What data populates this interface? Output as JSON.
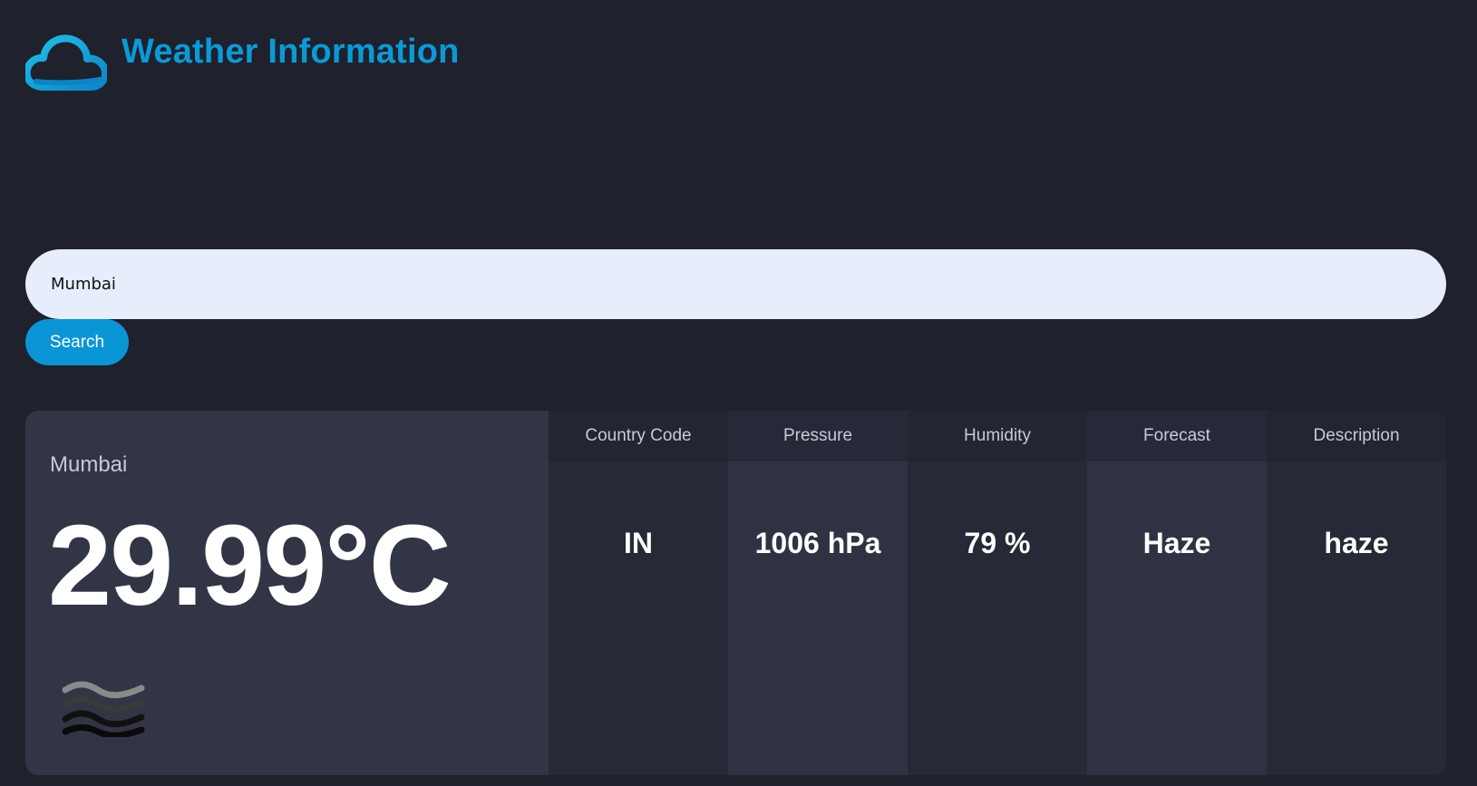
{
  "app": {
    "title": "Weather Information",
    "logo_icon": "cloud-icon",
    "accent_color": "#0a96d6"
  },
  "search": {
    "value": "Mumbai",
    "placeholder": "",
    "button_label": "Search"
  },
  "result": {
    "city": "Mumbai",
    "temperature": "29.99°C",
    "weather_icon": "haze-icon",
    "columns": [
      {
        "header": "Country Code",
        "value": "IN"
      },
      {
        "header": "Pressure",
        "value": "1006 hPa"
      },
      {
        "header": "Humidity",
        "value": "79 %"
      },
      {
        "header": "Forecast",
        "value": "Haze"
      },
      {
        "header": "Description",
        "value": "haze"
      }
    ]
  }
}
